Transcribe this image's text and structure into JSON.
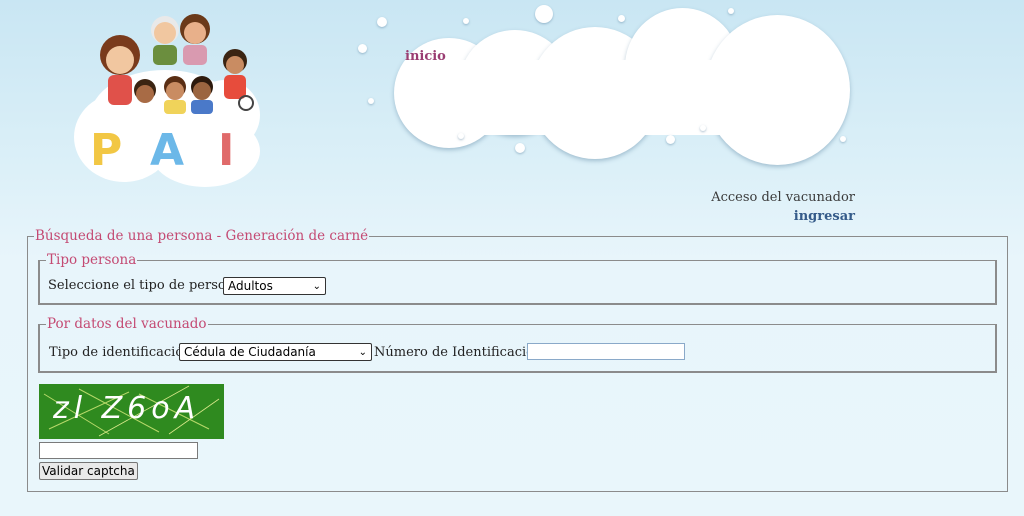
{
  "header": {
    "logo_text": "PAI",
    "logo_letters": [
      "P",
      "A",
      "I"
    ],
    "nav_inicio": "inicio",
    "acceso_label": "Acceso del vacunador",
    "ingresar_link": "ingresar"
  },
  "form": {
    "legend": "Búsqueda de una persona - Generación de carné",
    "tipo_persona": {
      "legend": "Tipo persona",
      "label": "Seleccione el tipo de persona:",
      "selected": "Adultos"
    },
    "datos_vacunado": {
      "legend": "Por datos del vacunado",
      "id_type_label": "Tipo de identificación",
      "id_type_selected": "Cédula de Ciudadanía",
      "id_number_label": "Número de Identificación",
      "id_number_value": ""
    },
    "captcha": {
      "image_text": "zl Z6oA",
      "input_value": "",
      "validate_button": "Validar captcha"
    }
  },
  "colors": {
    "legend": "#c44a73",
    "inicio": "#9a3d72",
    "ingresar": "#355b8a",
    "captcha_bg": "#2f8a1f",
    "logo_p": "#f2c744",
    "logo_a": "#6cb8e8",
    "logo_i": "#e06a6a"
  }
}
